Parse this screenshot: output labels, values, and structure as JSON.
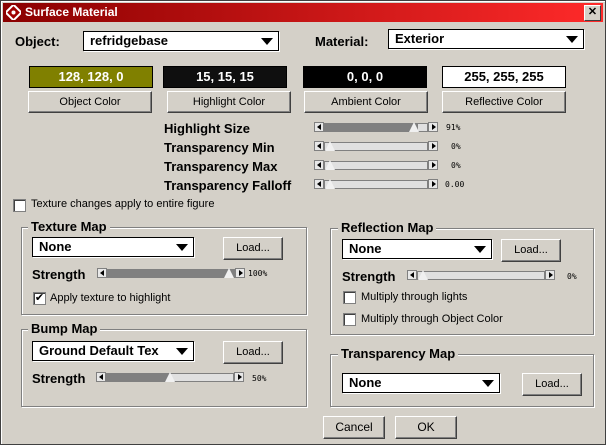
{
  "window": {
    "title": "Surface Material",
    "close_glyph": "✕"
  },
  "header": {
    "object_label": "Object:",
    "object_value": "refridgebase",
    "material_label": "Material:",
    "material_value": "Exterior"
  },
  "colors": [
    {
      "value": "128, 128, 0",
      "bg": "#808000",
      "fg": "#ffffff",
      "button": "Object Color"
    },
    {
      "value": "15, 15, 15",
      "bg": "#0f0f0f",
      "fg": "#ffffff",
      "button": "Highlight Color"
    },
    {
      "value": "0, 0, 0",
      "bg": "#000000",
      "fg": "#ffffff",
      "button": "Ambient Color"
    },
    {
      "value": "255, 255, 255",
      "bg": "#ffffff",
      "fg": "#000000",
      "button": "Reflective Color"
    }
  ],
  "params": [
    {
      "label": "Highlight Size",
      "value_text": "91%",
      "value": 0.91
    },
    {
      "label": "Transparency Min",
      "value_text": "0%",
      "value": 0.0
    },
    {
      "label": "Transparency Max",
      "value_text": "0%",
      "value": 0.0
    },
    {
      "label": "Transparency Falloff",
      "value_text": "0.00",
      "value": 0.0
    }
  ],
  "texture_all_checkbox": {
    "label": "Texture changes apply to entire figure",
    "checked": false
  },
  "texture_map": {
    "title": "Texture Map",
    "select_value": "None",
    "load_label": "Load...",
    "strength_label": "Strength",
    "strength_text": "100%",
    "strength": 1.0,
    "apply_highlight": {
      "label": "Apply texture to highlight",
      "checked": true
    }
  },
  "bump_map": {
    "title": "Bump Map",
    "select_value": "Ground Default Tex",
    "load_label": "Load...",
    "strength_label": "Strength",
    "strength_text": "50%",
    "strength": 0.5
  },
  "reflection_map": {
    "title": "Reflection Map",
    "select_value": "None",
    "load_label": "Load...",
    "strength_label": "Strength",
    "strength_text": "0%",
    "strength": 0.0,
    "multiply_lights": {
      "label": "Multiply through lights",
      "checked": false
    },
    "multiply_object": {
      "label": "Multiply through Object Color",
      "checked": false
    }
  },
  "transparency_map": {
    "title": "Transparency Map",
    "select_value": "None",
    "load_label": "Load..."
  },
  "footer": {
    "cancel_label": "Cancel",
    "ok_label": "OK"
  }
}
